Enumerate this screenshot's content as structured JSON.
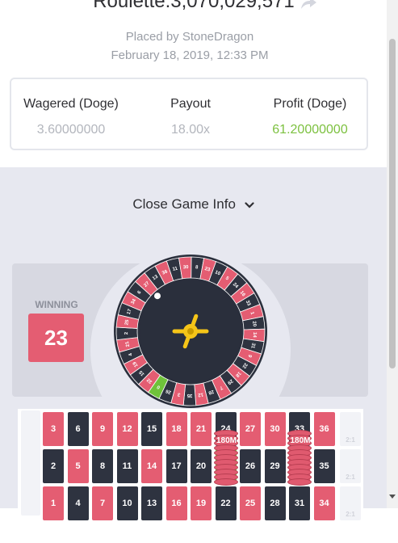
{
  "header": {
    "title": "Roulette:3,070,029,571",
    "placed_by": "Placed by StoneDragon",
    "date": "February 18, 2019, 12:33 PM"
  },
  "stats": [
    {
      "label": "Wagered (Doge)",
      "value": "3.60000000"
    },
    {
      "label": "Payout",
      "value": "18.00x"
    },
    {
      "label": "Profit (Doge)",
      "value": "61.20000000",
      "color": "#7dc140"
    }
  ],
  "toggle": {
    "label": "Close Game Info"
  },
  "result": {
    "label": "WINNING",
    "number": "23"
  },
  "wheel": {
    "sequence": [
      "0",
      "32",
      "15",
      "19",
      "4",
      "21",
      "2",
      "25",
      "17",
      "34",
      "6",
      "27",
      "13",
      "36",
      "11",
      "30",
      "8",
      "23",
      "10",
      "5",
      "24",
      "16",
      "33",
      "1",
      "20",
      "14",
      "31",
      "9",
      "22",
      "18",
      "29",
      "7",
      "28",
      "12",
      "35",
      "3",
      "26"
    ]
  },
  "board": {
    "rows": [
      [
        "3",
        "6",
        "9",
        "12",
        "15",
        "18",
        "21",
        "24",
        "27",
        "30",
        "33",
        "36"
      ],
      [
        "2",
        "5",
        "8",
        "11",
        "14",
        "17",
        "20",
        "23",
        "26",
        "29",
        "32",
        "35"
      ],
      [
        "1",
        "4",
        "7",
        "10",
        "13",
        "16",
        "19",
        "22",
        "25",
        "28",
        "31",
        "34"
      ]
    ],
    "column_label": "2:1",
    "chips": [
      {
        "label": "180M",
        "number": "23"
      },
      {
        "label": "180M",
        "number": "32"
      }
    ]
  },
  "colors": {
    "red": "#e45d72",
    "black": "#2e3340",
    "green": "#6fc23a",
    "profit": "#7dc140"
  }
}
